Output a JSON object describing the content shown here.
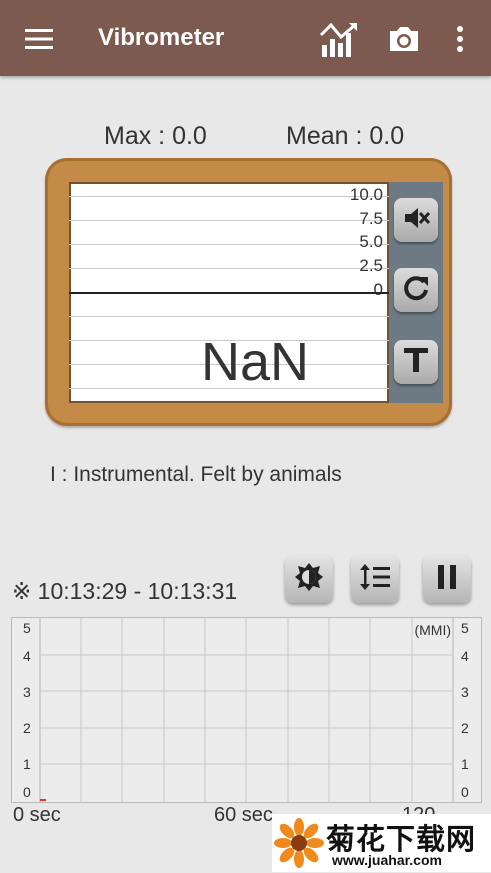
{
  "appbar": {
    "title": "Vibrometer",
    "color": "#7d5a4f",
    "icons": [
      "menu-icon",
      "chart-trend-icon",
      "camera-icon",
      "more-vert-icon"
    ]
  },
  "stats": {
    "max_label": "Max : 0.0",
    "mean_label": "Mean : 0.0"
  },
  "meter": {
    "ticks": [
      "10.0",
      "7.5",
      "5.0",
      "2.5",
      "0"
    ],
    "reading": "NaN",
    "buttons": [
      "mute-icon",
      "refresh-icon",
      "text-t-icon"
    ]
  },
  "description": "I   : Instrumental. Felt by animals",
  "time_range": "※ 10:13:29 - 10:13:31",
  "controls": [
    "brightness-icon",
    "line-spacing-icon",
    "pause-icon"
  ],
  "graph": {
    "unit_label": "(MMI)",
    "y_ticks": [
      "5",
      "4",
      "3",
      "2",
      "1",
      "0"
    ],
    "x_labels": [
      "0 sec",
      "60 sec",
      "120"
    ]
  },
  "watermark": {
    "name": "菊花下载网",
    "url": "www.juahar.com"
  }
}
